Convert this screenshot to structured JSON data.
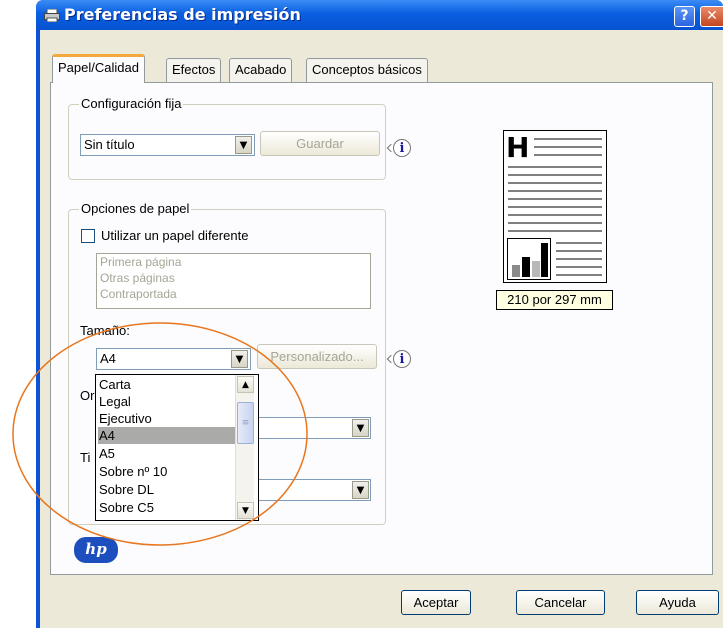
{
  "window": {
    "title": "Preferencias de impresión",
    "help_glyph": "?",
    "close_glyph": "✕"
  },
  "tabs": [
    {
      "label": "Papel/Calidad",
      "selected": true
    },
    {
      "label": "Efectos"
    },
    {
      "label": "Acabado"
    },
    {
      "label": "Conceptos básicos"
    }
  ],
  "config": {
    "group_label": "Configuración fija",
    "combo_value": "Sin título",
    "save_label": "Guardar",
    "info_glyph": "i"
  },
  "paper": {
    "group_label": "Opciones de papel",
    "checkbox_label": "Utilizar un papel diferente",
    "checkbox_checked": false,
    "pages": [
      "Primera página",
      "Otras páginas",
      "Contraportada"
    ],
    "size_label": "Tamaño:",
    "size_value": "A4",
    "custom_label": "Personalizado...",
    "info_glyph": "i",
    "orientation_label_partial": "Or",
    "type_label_partial": "Ti"
  },
  "size_dropdown": {
    "items": [
      "Carta",
      "Legal",
      "Ejecutivo",
      "A4",
      "A5",
      "Sobre nº 10",
      "Sobre DL",
      "Sobre C5"
    ],
    "selected_index": 3
  },
  "preview": {
    "glyph": "H",
    "size_caption": "210 por 297 mm"
  },
  "logo": {
    "text": "hp"
  },
  "buttons": {
    "ok": "Aceptar",
    "cancel": "Cancelar",
    "help": "Ayuda"
  },
  "colors": {
    "title_bar": "#0a5fe0",
    "tab_highlight": "#f5a83c",
    "annotation": "#e8761e",
    "selected_item": "#aaaaa8"
  }
}
